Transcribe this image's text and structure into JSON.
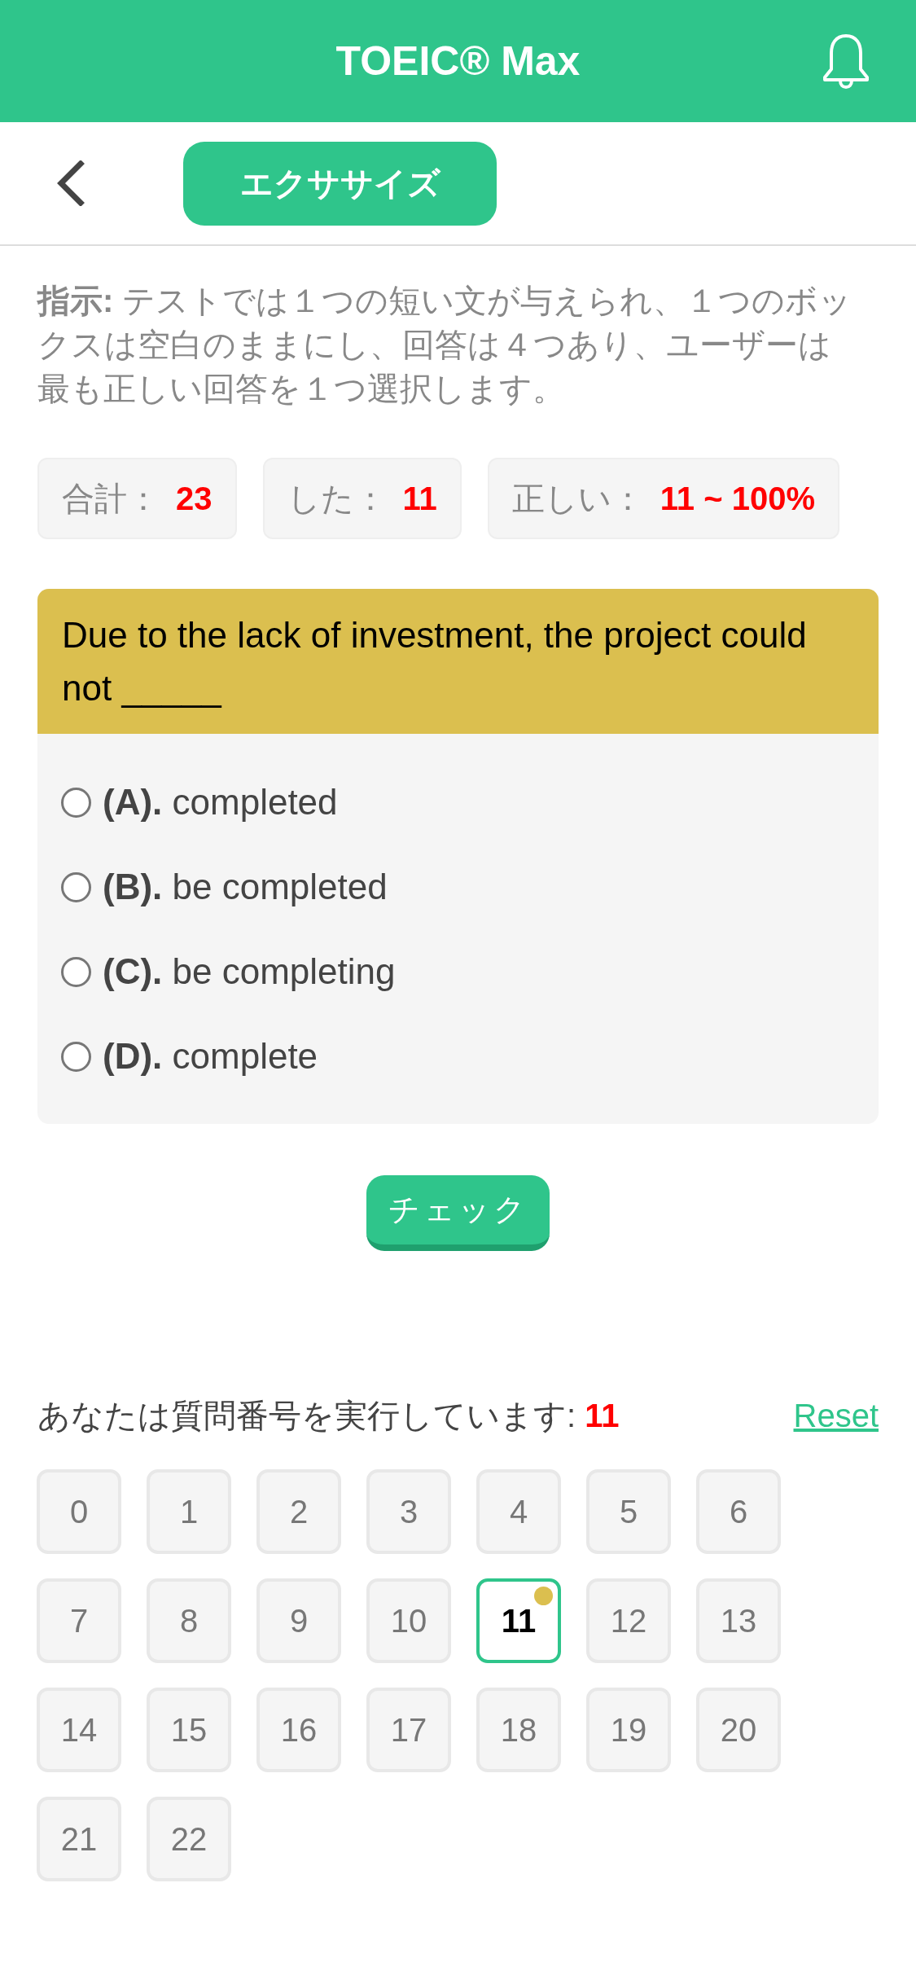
{
  "header": {
    "title": "TOEIC® Max"
  },
  "nav": {
    "exercise_button": "エクササイズ"
  },
  "instructions": "**指示:** テストでは１つの短い文が与えられ、１つのボックスは空白のままにし、回答は４つあり、ユーザーは最も正しい回答を１つ選択します。",
  "stats": [
    {
      "label": "合計：",
      "value": "23"
    },
    {
      "label": "した：",
      "value": "11"
    },
    {
      "label": "正しい：",
      "value": "11 ~ 100%"
    }
  ],
  "question": {
    "text": "Due to the lack of investment, the project could not _____",
    "options": [
      {
        "letter": "(A).",
        "text": "completed",
        "selected": false
      },
      {
        "letter": "(B).",
        "text": "be completed",
        "selected": false
      },
      {
        "letter": "(C).",
        "text": "be completing",
        "selected": false
      },
      {
        "letter": "(D).",
        "text": "complete",
        "selected": false
      }
    ]
  },
  "check_button": "チェック",
  "progress": {
    "label": "あなたは質問番号を実行しています:",
    "current": "11",
    "reset": "Reset"
  },
  "questions": [
    {
      "number": "0",
      "selected": false,
      "marked": false
    },
    {
      "number": "1",
      "selected": false,
      "marked": false
    },
    {
      "number": "2",
      "selected": false,
      "marked": false
    },
    {
      "number": "3",
      "selected": false,
      "marked": false
    },
    {
      "number": "4",
      "selected": false,
      "marked": false
    },
    {
      "number": "5",
      "selected": false,
      "marked": false
    },
    {
      "number": "6",
      "selected": false,
      "marked": false
    },
    {
      "number": "7",
      "selected": false,
      "marked": false
    },
    {
      "number": "8",
      "selected": false,
      "marked": false
    },
    {
      "number": "9",
      "selected": false,
      "marked": false
    },
    {
      "number": "10",
      "selected": false,
      "marked": false
    },
    {
      "number": "11",
      "selected": true,
      "marked": true
    },
    {
      "number": "12",
      "selected": false,
      "marked": false
    },
    {
      "number": "13",
      "selected": false,
      "marked": false
    },
    {
      "number": "14",
      "selected": false,
      "marked": false
    },
    {
      "number": "15",
      "selected": false,
      "marked": false
    },
    {
      "number": "16",
      "selected": false,
      "marked": false
    },
    {
      "number": "17",
      "selected": false,
      "marked": false
    },
    {
      "number": "18",
      "selected": false,
      "marked": false
    },
    {
      "number": "19",
      "selected": false,
      "marked": false
    },
    {
      "number": "20",
      "selected": false,
      "marked": false
    },
    {
      "number": "21",
      "selected": false,
      "marked": false
    },
    {
      "number": "22",
      "selected": false,
      "marked": false
    }
  ]
}
